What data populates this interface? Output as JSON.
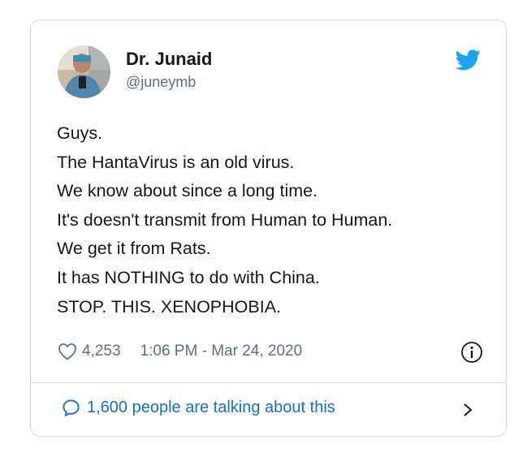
{
  "tweet": {
    "author_name": "Dr. Junaid",
    "author_handle": "@juneymb",
    "lines": [
      "Guys.",
      "The HantaVirus is an old virus.",
      "We know about since a long time.",
      "It's doesn't transmit from Human to Human.",
      "We get it from Rats.",
      "It has NOTHING to do with China.",
      "STOP. THIS. XENOPHOBIA."
    ],
    "likes": "4,253",
    "timestamp": "1:06 PM - Mar 24, 2020",
    "conversation": "1,600 people are talking about this"
  },
  "icons": {
    "brand": "twitter-bird-icon",
    "like": "heart-icon",
    "info": "info-icon",
    "reply": "speech-bubble-icon",
    "more": "chevron-right-icon"
  },
  "colors": {
    "twitter_blue": "#1da1f2",
    "link_blue": "#1b6fbf",
    "secondary_text": "#5b7083",
    "border": "#d5dbe0"
  }
}
